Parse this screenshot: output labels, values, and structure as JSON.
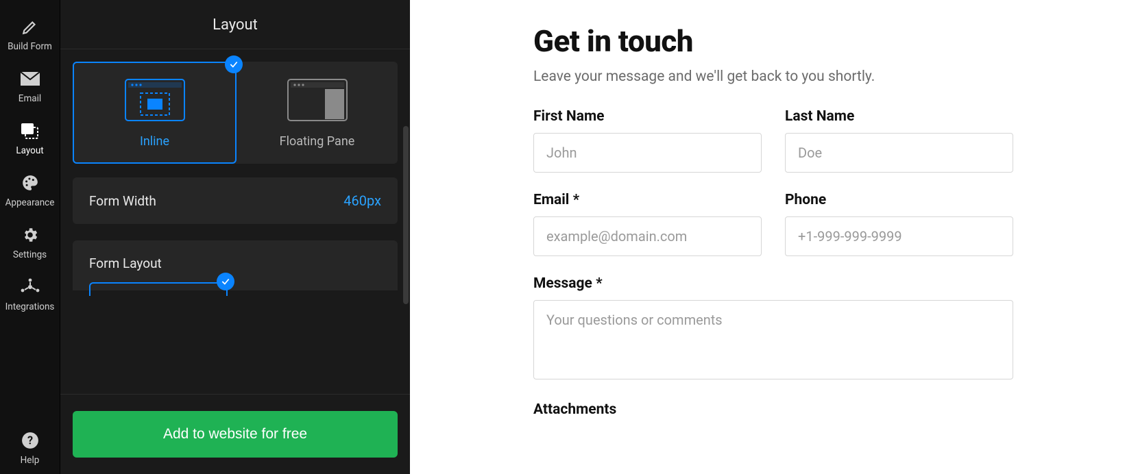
{
  "rail": {
    "items": [
      {
        "id": "build",
        "label": "Build Form"
      },
      {
        "id": "email",
        "label": "Email"
      },
      {
        "id": "layout",
        "label": "Layout"
      },
      {
        "id": "appearance",
        "label": "Appearance"
      },
      {
        "id": "settings",
        "label": "Settings"
      },
      {
        "id": "integrations",
        "label": "Integrations"
      },
      {
        "id": "help",
        "label": "Help"
      }
    ],
    "active": "layout"
  },
  "panel": {
    "title": "Layout",
    "layout_modes": {
      "inline": "Inline",
      "floating": "Floating Pane",
      "selected": "inline"
    },
    "form_width": {
      "label": "Form Width",
      "value": "460px"
    },
    "form_layout": {
      "label": "Form Layout"
    },
    "cta": "Add to website for free"
  },
  "form": {
    "title": "Get in touch",
    "subtitle": "Leave your message and we'll get back to you shortly.",
    "fields": {
      "first_name": {
        "label": "First Name",
        "placeholder": "John"
      },
      "last_name": {
        "label": "Last Name",
        "placeholder": "Doe"
      },
      "email": {
        "label": "Email *",
        "placeholder": "example@domain.com"
      },
      "phone": {
        "label": "Phone",
        "placeholder": "+1-999-999-9999"
      },
      "message": {
        "label": "Message *",
        "placeholder": "Your questions or comments"
      },
      "attachments": {
        "label": "Attachments"
      }
    }
  }
}
